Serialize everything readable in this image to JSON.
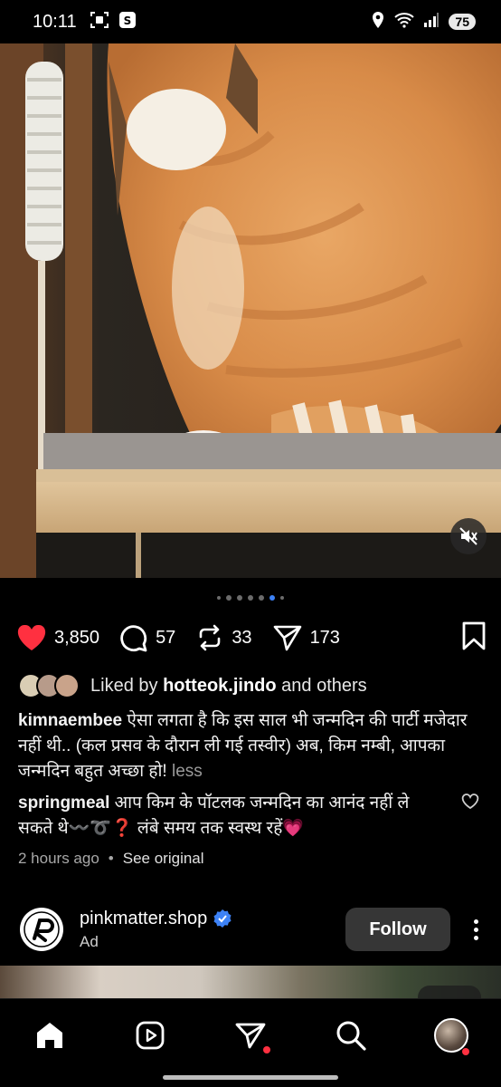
{
  "status_bar": {
    "time": "10:11",
    "battery": "75",
    "icons": [
      "screenshot-icon",
      "app-notification-icon",
      "location-icon",
      "wifi-icon",
      "signal-icon"
    ]
  },
  "post": {
    "image_icon": "orange-tabby-cat-photo",
    "carousel": {
      "count": 7,
      "active_index": 5
    },
    "actions": {
      "likes": "3,850",
      "comments": "57",
      "reposts": "33",
      "shares": "173"
    },
    "liked_by": {
      "prefix": "Liked by",
      "user": "hotteok.jindo",
      "suffix": "and others"
    },
    "caption": {
      "user": "kimnaembee",
      "text": "ऐसा लगता है कि इस साल भी जन्मदिन की पार्टी मजेदार नहीं थी.. (कल प्रसव के दौरान ली गई तस्वीर) अब, किम नम्बी, आपका जन्मदिन बहुत अच्छा हो!",
      "more": "less"
    },
    "top_comment": {
      "user": "springmeal",
      "text": "आप किम के पॉटलक जन्मदिन का आनंद नहीं ले सकते थे〰️➰❓ लंबे समय तक स्वस्थ रहें💗"
    },
    "time_ago": "2 hours ago",
    "separator": "•",
    "see_original": "See original"
  },
  "ad": {
    "name": "pinkmatter.shop",
    "label": "Ad",
    "follow": "Follow",
    "verified_color": "#3d82f6"
  },
  "colors": {
    "like_red": "#ff3040",
    "accent_blue": "#3d82f6",
    "background": "#000000"
  },
  "nav": [
    "home-icon",
    "reels-icon",
    "direct-messages-icon",
    "search-icon",
    "profile-avatar"
  ]
}
